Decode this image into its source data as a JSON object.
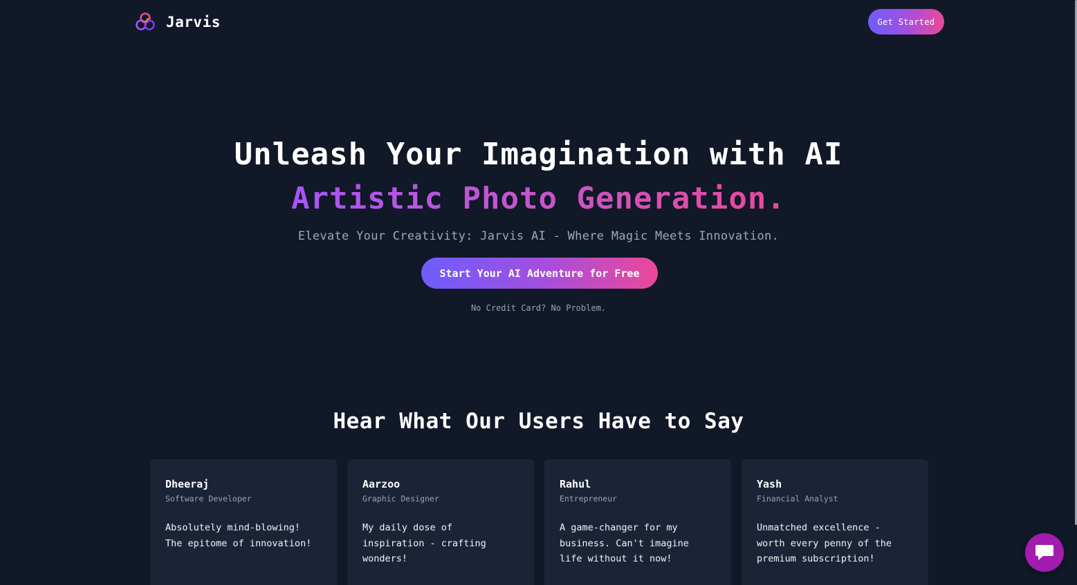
{
  "header": {
    "brand": "Jarvis",
    "logo_icon": "three-rings-logo-icon",
    "cta_label": "Get Started"
  },
  "hero": {
    "title": "Unleash Your Imagination with AI",
    "subtitle": "Artistic Photo Generation.",
    "tagline": "Elevate Your Creativity: Jarvis AI - Where Magic Meets Innovation.",
    "cta_label": "Start Your AI Adventure for Free",
    "note": "No Credit Card? No Problem."
  },
  "testimonials": {
    "title": "Hear What Our Users Have to Say",
    "items": [
      {
        "name": "Dheeraj",
        "role": "Software Developer",
        "quote": "Absolutely mind-blowing! The epitome of innovation!"
      },
      {
        "name": "Aarzoo",
        "role": "Graphic Designer",
        "quote": "My daily dose of inspiration - crafting wonders!"
      },
      {
        "name": "Rahul",
        "role": "Entrepreneur",
        "quote": "A game-changer for my business. Can't imagine life without it now!"
      },
      {
        "name": "Yash",
        "role": "Financial Analyst",
        "quote": "Unmatched excellence - worth every penny of the premium subscription!"
      }
    ]
  },
  "chat": {
    "icon": "chat-bubble-icon"
  },
  "colors": {
    "background": "#111827",
    "card": "#1b2437",
    "gradient_start": "#6d5dfc",
    "gradient_end": "#ec4899",
    "chat_button": "#a21caf"
  }
}
